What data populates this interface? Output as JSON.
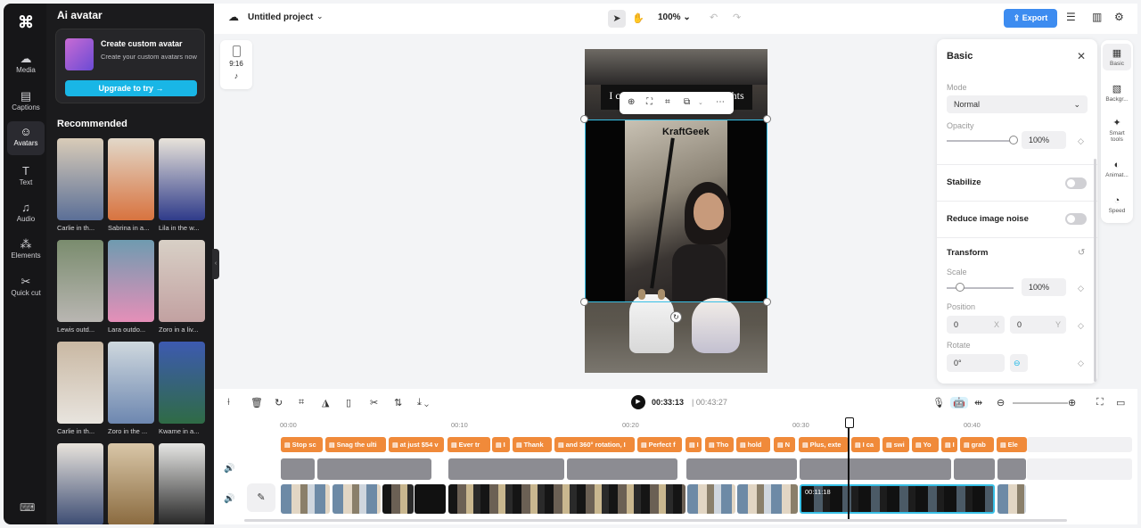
{
  "rail": {
    "items": [
      {
        "label": "Media",
        "icon": "media-icon"
      },
      {
        "label": "Captions",
        "icon": "captions-icon"
      },
      {
        "label": "Avatars",
        "icon": "avatar-icon"
      },
      {
        "label": "Text",
        "icon": "text-icon"
      },
      {
        "label": "Audio",
        "icon": "audio-icon"
      },
      {
        "label": "Elements",
        "icon": "elements-icon"
      },
      {
        "label": "Quick cut",
        "icon": "quick-cut-icon"
      }
    ],
    "active": "Avatars"
  },
  "panel": {
    "title": "Ai avatar",
    "promo": {
      "title": "Create custom avatar",
      "subtitle": "Create your custom avatars now",
      "button": "Upgrade to try"
    },
    "section": "Recommended",
    "avatars": [
      "Carlie in th...",
      "Sabrina in a...",
      "Lila in the w...",
      "Lewis outd...",
      "Lara outdo...",
      "Zoro in a liv...",
      "Carlie in th...",
      "Zoro in the ...",
      "Kwame in a...",
      "",
      "",
      ""
    ]
  },
  "topbar": {
    "project": "Untitled project",
    "zoom": "100%",
    "export": "Export"
  },
  "canvas": {
    "aspect": "9:16",
    "subtitle": "I can tend to animate my nights",
    "watermark": "KraftGeek"
  },
  "props": {
    "tab_title": "Basic",
    "mode_label": "Mode",
    "mode_value": "Normal",
    "opacity_label": "Opacity",
    "opacity_value": "100%",
    "opacity": 1.0,
    "stabilize": "Stabilize",
    "reduce_noise": "Reduce image noise",
    "transform": "Transform",
    "scale_label": "Scale",
    "scale_value": "100%",
    "position_label": "Position",
    "pos_x": "0",
    "pos_x_axis": "X",
    "pos_y": "0",
    "pos_y_axis": "Y",
    "rotate_label": "Rotate",
    "rotate_value": "0°"
  },
  "side_tabs": [
    {
      "label": "Basic",
      "icon": "basic-icon"
    },
    {
      "label": "Backgr...",
      "icon": "background-icon"
    },
    {
      "label": "Smart tools",
      "icon": "smart-tools-icon"
    },
    {
      "label": "Animat...",
      "icon": "animation-icon"
    },
    {
      "label": "Speed",
      "icon": "speed-icon"
    }
  ],
  "timeline": {
    "current": "00:33:13",
    "total": "00:43:27",
    "ruler": [
      "00:00",
      "00:10",
      "00:20",
      "00:30",
      "00:40"
    ],
    "captions": [
      "Stop sc",
      "Snag the ulti",
      "at just $54 v",
      "Ever tr",
      "I",
      "Thank",
      "and 360° rotation, I",
      "Perfect f",
      "I",
      "Tho",
      "hold",
      "N",
      "Plus, exte",
      "I ca",
      "swi",
      "Yo",
      "I",
      "grab",
      "Ele"
    ],
    "selected_clip_time": "00:11:18"
  }
}
